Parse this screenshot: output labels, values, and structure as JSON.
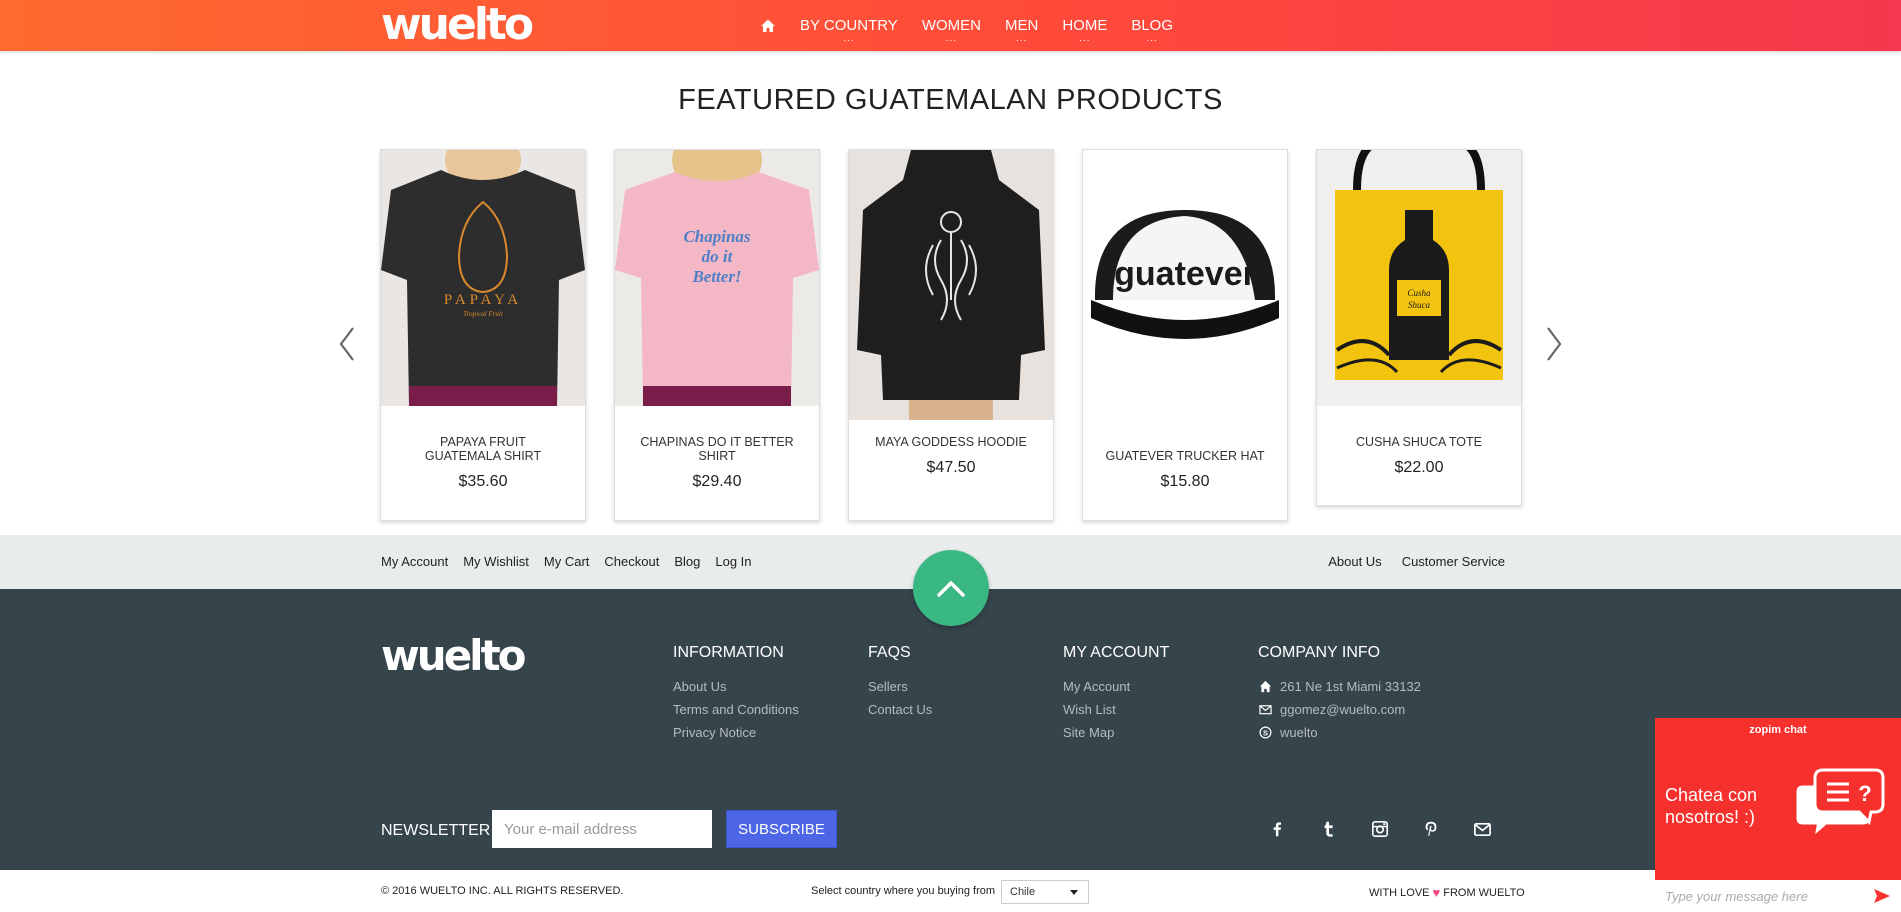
{
  "header": {
    "logo": "wuelto",
    "nav": [
      {
        "label": "BY COUNTRY"
      },
      {
        "label": "WOMEN"
      },
      {
        "label": "MEN"
      },
      {
        "label": "HOME"
      },
      {
        "label": "BLOG"
      }
    ],
    "dots": "..."
  },
  "featured": {
    "title": "FEATURED GUATEMALAN PRODUCTS",
    "products": [
      {
        "name": "PAPAYA FRUIT GUATEMALA SHIRT",
        "price": "$35.60",
        "art_text": "PAPAYA",
        "art_sub": "Tropical Fruit"
      },
      {
        "name": "CHAPINAS DO IT BETTER SHIRT",
        "price": "$29.40",
        "art_text": "Chapinas do it Better!"
      },
      {
        "name": "MAYA GODDESS HOODIE",
        "price": "$47.50"
      },
      {
        "name": "GUATEVER TRUCKER HAT",
        "price": "$15.80",
        "art_text": "guatever"
      },
      {
        "name": "CUSHA SHUCA TOTE",
        "price": "$22.00",
        "art_text": "Cusha Shuca"
      }
    ]
  },
  "linkbar": {
    "left": [
      "My Account",
      "My Wishlist",
      "My Cart",
      "Checkout",
      "Blog",
      "Log In"
    ],
    "right": [
      "About Us",
      "Customer Service"
    ]
  },
  "footer": {
    "logo": "wuelto",
    "information": {
      "title": "INFORMATION",
      "links": [
        "About Us",
        "Terms and Conditions",
        "Privacy Notice"
      ]
    },
    "faqs": {
      "title": "FAQS",
      "links": [
        "Sellers",
        "Contact Us"
      ]
    },
    "account": {
      "title": "MY ACCOUNT",
      "links": [
        "My Account",
        "Wish List",
        "Site Map"
      ]
    },
    "company": {
      "title": "COMPANY INFO",
      "address": "261 Ne 1st Miami 33132",
      "email": "ggomez@wuelto.com",
      "skype": "wuelto"
    },
    "newsletter": {
      "label": "NEWSLETTER",
      "placeholder": "Your e-mail address",
      "button": "SUBSCRIBE"
    },
    "social_icons": [
      "facebook-icon",
      "twitter-icon",
      "instagram-icon",
      "pinterest-icon",
      "mail-icon"
    ]
  },
  "bottom": {
    "copyright": "© 2016 WUELTO INC. ALL RIGHTS RESERVED.",
    "country_label": "Select country where you buying from",
    "country_value": "Chile",
    "love_prefix": "WITH LOVE",
    "love_suffix": "FROM WUELTO"
  },
  "chat": {
    "brand": "zopim chat",
    "message": "Chatea con nosotros! :)",
    "placeholder": "Type your message here"
  },
  "colors": {
    "header_start": "#ff6a2f",
    "header_end": "#f4384d",
    "footer_bg": "#36444c",
    "to_top": "#3ab883",
    "subscribe": "#4c66e6",
    "chat": "#f6302d"
  }
}
